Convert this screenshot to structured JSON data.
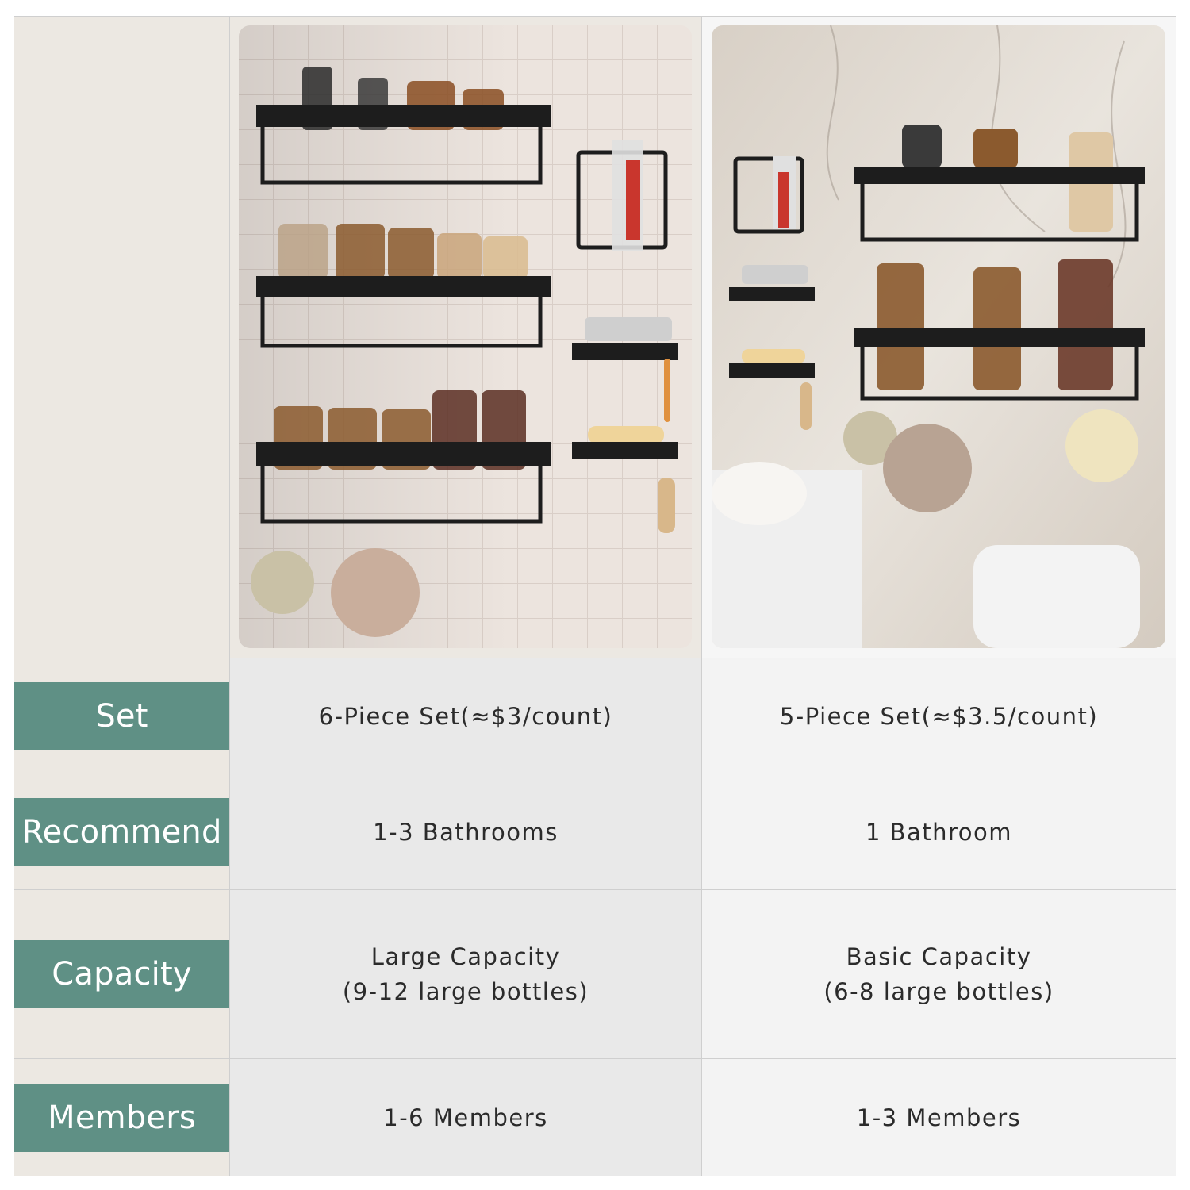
{
  "rows": [
    {
      "label": "Set",
      "option_a": "6-Piece Set(≈$3/count)",
      "option_b": "5-Piece Set(≈$3.5/count)"
    },
    {
      "label": "Recommend",
      "option_a": "1-3 Bathrooms",
      "option_b": "1 Bathroom"
    },
    {
      "label": "Capacity",
      "option_a_lines": [
        "Large Capacity",
        "(9-12 large bottles)"
      ],
      "option_b_lines": [
        "Basic Capacity",
        "(6-8 large bottles)"
      ]
    },
    {
      "label": "Members",
      "option_a": "1-6 Members",
      "option_b": "1-3 Members"
    }
  ],
  "images": {
    "option_a": "tiled-wall-shower-caddy-6-piece-photo",
    "option_b": "marble-bathroom-shower-caddy-5-piece-photo"
  },
  "colors": {
    "label_band": "#5f9085",
    "label_text": "#ffffff",
    "label_column_bg": "#ece8e2",
    "option_a_bg": "#e9e9e9",
    "option_b_bg": "#f3f3f3",
    "grid_line": "#cfcfcf",
    "value_text": "#2b2b2b"
  }
}
